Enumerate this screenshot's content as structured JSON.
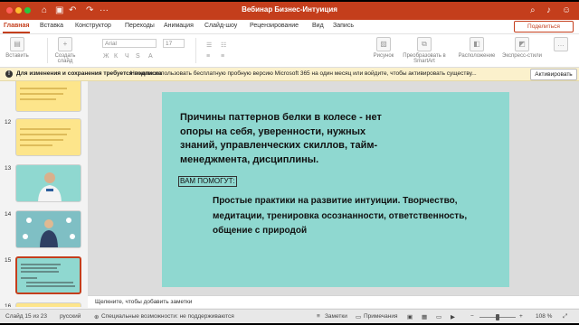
{
  "app": {
    "title": "Вебинар Бизнес-Интуиция"
  },
  "ribbon_tabs": [
    "Главная",
    "Вставка",
    "Конструктор",
    "Переходы",
    "Анимация",
    "Слайд-шоу",
    "Рецензирование",
    "Вид",
    "Запись"
  ],
  "share_label": "Поделиться",
  "ribbon": {
    "paste_label": "Вставить",
    "create_slide_label": "Создать слайд",
    "font_name": "Arial",
    "font_size": "17",
    "drawing_label": "Рисунок",
    "smartart_label": "Преобразовать в SmartArt",
    "arrange_label": "Расположение",
    "express_label": "Экспресс-стили"
  },
  "notification": {
    "bold": "Для изменения и сохранения требуется подписка",
    "text": "Начните использовать бесплатную пробную версию Microsoft 365 на один месяц или войдите, чтобы активировать существу...",
    "button": "Активировать"
  },
  "thumbnails": [
    {
      "num": "",
      "style": "yellow"
    },
    {
      "num": "12",
      "style": "yellow"
    },
    {
      "num": "13",
      "style": "teal"
    },
    {
      "num": "14",
      "style": "teal"
    },
    {
      "num": "15",
      "style": "teal-selected"
    },
    {
      "num": "16",
      "style": "yellow"
    }
  ],
  "slide": {
    "title": "Причины паттернов белки в колесе - нет опоры на себя, уверенности, нужных знаний, управленческих скиллов, тайм-менеджмента, дисциплины.",
    "help_label": "ВАМ ПОМОГУТ:",
    "practices": "Простые практики на развитие интуиции. Творчество, медитации, тренировка осознанности, ответственность, общение с природой"
  },
  "notes_placeholder": "Щелкните, чтобы добавить заметки",
  "status": {
    "slide": "Слайд 15 из 23",
    "language": "русский",
    "accessibility": "Специальные возможности: не поддерживаются",
    "notes": "Заметки",
    "comments": "Примечания",
    "zoom": "108 %"
  },
  "colors": {
    "accent": "#c43e1c",
    "slide_bg": "#8fd8d0",
    "thumb_yellow": "#fde58b"
  }
}
